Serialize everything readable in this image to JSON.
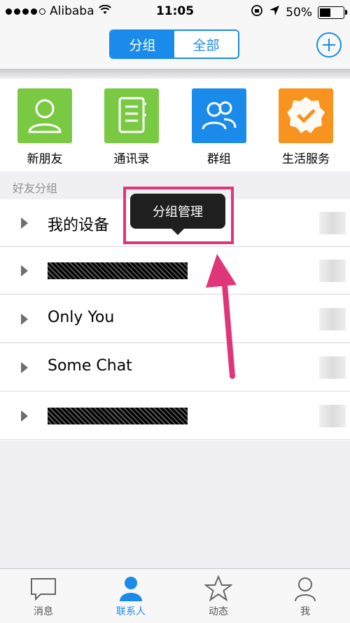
{
  "status_bar": {
    "carrier": "Alibaba",
    "time": "11:05",
    "battery_percent": "50%",
    "battery_level": 0.5
  },
  "nav": {
    "segments": [
      {
        "label": "分组",
        "active": true
      },
      {
        "label": "全部",
        "active": false
      }
    ],
    "add_icon": "plus-circle-icon"
  },
  "tiles": [
    {
      "label": "新朋友",
      "icon": "person-icon",
      "color": "#7ac943"
    },
    {
      "label": "通讯录",
      "icon": "address-book-icon",
      "color": "#7ac943"
    },
    {
      "label": "群组",
      "icon": "group-icon",
      "color": "#1a8bea"
    },
    {
      "label": "生活服务",
      "icon": "badge-check-icon",
      "color": "#f7931e"
    }
  ],
  "section": {
    "title": "好友分组"
  },
  "groups": [
    {
      "name": "我的设备",
      "masked": false
    },
    {
      "name": "",
      "masked": true
    },
    {
      "name": "Only You",
      "masked": false
    },
    {
      "name": "Some Chat",
      "masked": false
    },
    {
      "name": "",
      "masked": true
    }
  ],
  "tooltip": {
    "text": "分组管理"
  },
  "tabs": [
    {
      "label": "消息",
      "icon": "chat-bubble-icon",
      "active": false
    },
    {
      "label": "联系人",
      "icon": "person-icon",
      "active": true
    },
    {
      "label": "动态",
      "icon": "star-icon",
      "active": false
    },
    {
      "label": "我",
      "icon": "user-outline-icon",
      "active": false
    }
  ],
  "colors": {
    "accent": "#1a8bea",
    "highlight": "#e0357a"
  }
}
